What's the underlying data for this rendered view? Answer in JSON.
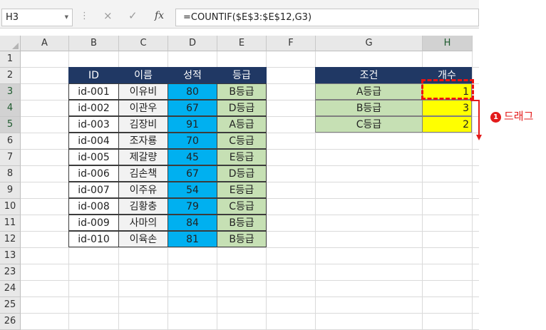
{
  "formula_bar": {
    "name_box": "H3",
    "cancel_glyph": "×",
    "confirm_glyph": "✓",
    "fx_label": "fx",
    "formula": "=COUNTIF($E$3:$E$12,G3)"
  },
  "columns": [
    "A",
    "B",
    "C",
    "D",
    "E",
    "F",
    "G",
    "H"
  ],
  "rows": [
    "1",
    "2",
    "3",
    "4",
    "5",
    "6",
    "7",
    "8",
    "9",
    "10",
    "11",
    "12",
    "13",
    "23",
    "24",
    "25",
    "26"
  ],
  "table": {
    "headers": [
      "ID",
      "이름",
      "성적",
      "등급"
    ],
    "records": [
      {
        "id": "id-001",
        "name": "이유비",
        "score": "80",
        "grade": "B등급"
      },
      {
        "id": "id-002",
        "name": "이관우",
        "score": "67",
        "grade": "D등급"
      },
      {
        "id": "id-003",
        "name": "김장비",
        "score": "91",
        "grade": "A등급"
      },
      {
        "id": "id-004",
        "name": "조자룡",
        "score": "70",
        "grade": "C등급"
      },
      {
        "id": "id-005",
        "name": "제갈량",
        "score": "45",
        "grade": "E등급"
      },
      {
        "id": "id-006",
        "name": "김손책",
        "score": "67",
        "grade": "D등급"
      },
      {
        "id": "id-007",
        "name": "이주유",
        "score": "54",
        "grade": "E등급"
      },
      {
        "id": "id-008",
        "name": "김황충",
        "score": "79",
        "grade": "C등급"
      },
      {
        "id": "id-009",
        "name": "사마의",
        "score": "84",
        "grade": "B등급"
      },
      {
        "id": "id-010",
        "name": "이육손",
        "score": "81",
        "grade": "B등급"
      }
    ]
  },
  "summary": {
    "headers": [
      "조건",
      "개수"
    ],
    "rows": [
      {
        "condition": "A등급",
        "count": "1"
      },
      {
        "condition": "B등급",
        "count": "3"
      },
      {
        "condition": "C등급",
        "count": "2"
      }
    ]
  },
  "annotation": {
    "number": "1",
    "text": "드래그"
  },
  "colors": {
    "header_bg": "#203864",
    "score_bg": "#00b0f0",
    "grade_bg": "#c6e0b4",
    "count_bg": "#ffff00",
    "annotation": "#e31b1b"
  }
}
